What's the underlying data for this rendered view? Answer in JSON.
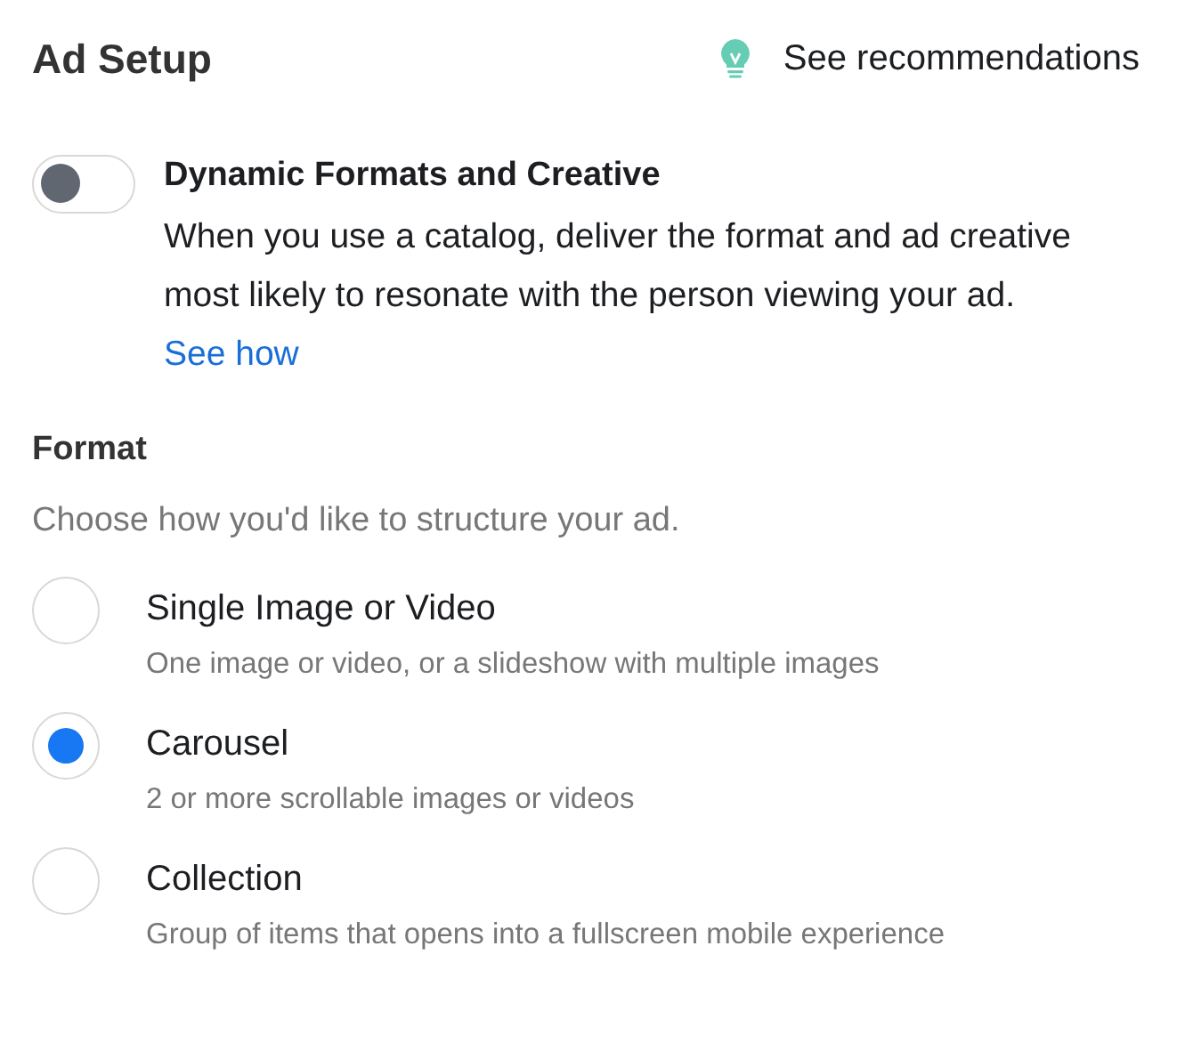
{
  "header": {
    "title": "Ad Setup",
    "recommendations_link": "See recommendations"
  },
  "dynamic_toggle": {
    "title": "Dynamic Formats and Creative",
    "on": false,
    "description": "When you use a catalog, deliver the format and ad creative most likely to resonate with the person viewing your ad.",
    "link": "See how"
  },
  "format": {
    "title": "Format",
    "subtitle": "Choose how you'd like to structure your ad.",
    "options": [
      {
        "label": "Single Image or Video",
        "description": "One image or video, or a slideshow with multiple images",
        "selected": false
      },
      {
        "label": "Carousel",
        "description": "2 or more scrollable images or videos",
        "selected": true
      },
      {
        "label": "Collection",
        "description": "Group of items that opens into a fullscreen mobile experience",
        "selected": false
      }
    ]
  }
}
